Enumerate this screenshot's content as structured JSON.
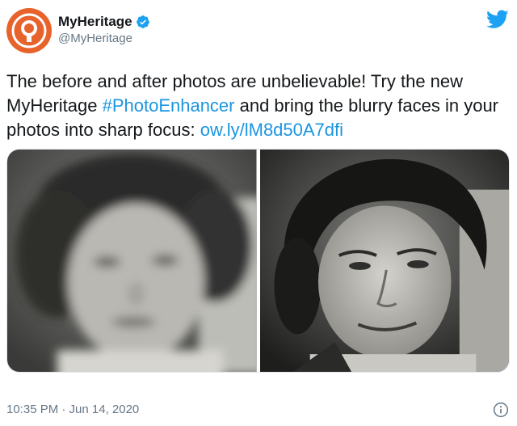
{
  "account": {
    "display_name": "MyHeritage",
    "handle": "@MyHeritage",
    "avatar_icon": "myheritage-logo-icon",
    "verified_icon": "verified-badge-icon"
  },
  "tweet": {
    "text_before_hashtag": "The before and after photos are unbelievable! Try the new MyHeritage ",
    "hashtag": "#PhotoEnhancer",
    "text_after_hashtag": " and bring the blurry faces in your photos into sharp focus: ",
    "link": "ow.ly/lM8d50A7dfi"
  },
  "footer": {
    "timestamp": "10:35 PM · Jun 14, 2020"
  },
  "colors": {
    "link": "#1b95e0",
    "brand_orange": "#e8622b",
    "twitter_blue": "#1da1f2",
    "secondary_text": "#657786"
  },
  "icons": {
    "platform": "twitter-bird-icon",
    "info": "info-icon"
  }
}
